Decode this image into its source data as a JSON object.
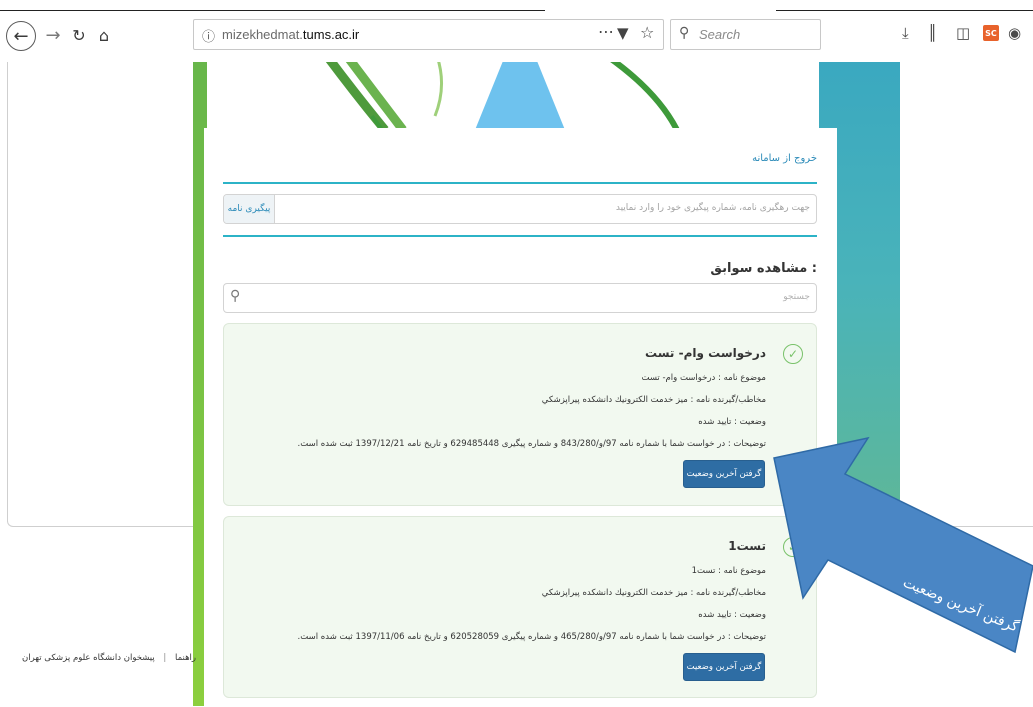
{
  "browser": {
    "url_prefix": "mizekhedmat.",
    "url_domain": "tums.ac.ir",
    "more_icon": "⋯",
    "search_placeholder": "Search"
  },
  "page": {
    "logout_label": "خروج از سامانه",
    "tracking": {
      "placeholder": "جهت رهگیری نامه، شماره پیگیری خود را وارد نمایید",
      "button_label": "پیگیری نامه"
    },
    "history_title": "مشاهده سوابق :",
    "search_placeholder": "جستجو",
    "records": [
      {
        "title": "درخواست وام- تست",
        "subject": "موضوع نامه : درخواست وام- تست",
        "recipient": "مخاطب/گیرنده نامه : میز خدمت الکترونیك دانشكده پیراپزشكي",
        "status": "وضعیت : تایید شده",
        "description": "توضیحات : در خواست شما با شماره نامه 97/و/843/280 و شماره پیگیری 629485448 و تاریخ نامه 1397/12/21 ثبت شده است.",
        "button_label": "گرفتن آخرین وضعیت"
      },
      {
        "title": "تست1",
        "subject": "موضوع نامه : تست1",
        "recipient": "مخاطب/گیرنده نامه : میز خدمت الکترونیك دانشكده پیراپزشكي",
        "status": "وضعیت : تایید شده",
        "description": "توضیحات : در خواست شما با شماره نامه 97/و/465/280 و شماره پیگیری 620528059 و تاریخ نامه 1397/11/06 ثبت شده است.",
        "button_label": "گرفتن آخرین وضعیت"
      }
    ],
    "footer": {
      "site_name": "پیشخوان دانشگاه علوم پزشکی تهران",
      "separator": "|",
      "help_label": "راهنما"
    }
  },
  "annotation": {
    "label": "گرفتن آخرین وضعیت",
    "arrow_color": "#4a86c5"
  },
  "colors": {
    "accent": "#2cb3c7",
    "button": "#2e6da4",
    "record_bg": "#f2f9f0",
    "check": "#79c26a"
  },
  "icons": [
    "back-icon",
    "forward-icon",
    "reload-icon",
    "home-icon",
    "info-icon",
    "pocket-icon",
    "bookmark-star-icon",
    "search-icon",
    "download-icon",
    "library-icon",
    "sidebar-icon",
    "sc-extension-icon",
    "account-icon",
    "check-circle-icon"
  ]
}
